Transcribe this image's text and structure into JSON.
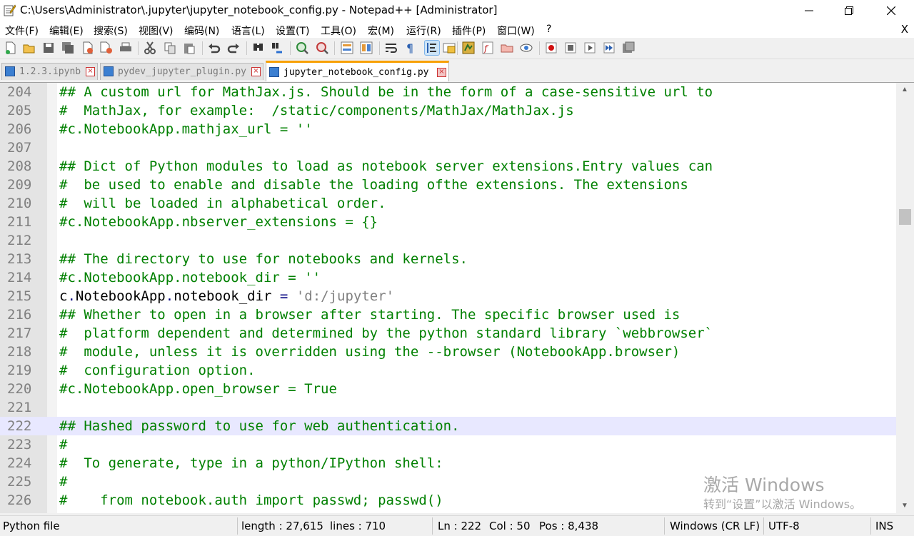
{
  "window": {
    "title": "C:\\Users\\Administrator\\.jupyter\\jupyter_notebook_config.py - Notepad++ [Administrator]",
    "minimize": "—",
    "maximize": "☐",
    "close": "✕"
  },
  "menu": {
    "items": [
      "文件(F)",
      "编辑(E)",
      "搜索(S)",
      "视图(V)",
      "编码(N)",
      "语言(L)",
      "设置(T)",
      "工具(O)",
      "宏(M)",
      "运行(R)",
      "插件(P)",
      "窗口(W)",
      "?"
    ],
    "close": "X"
  },
  "toolbar": {
    "icons": [
      "new-file-icon",
      "open-file-icon",
      "save-icon",
      "save-all-icon",
      "close-icon",
      "close-all-icon",
      "print-icon",
      "cut-icon",
      "copy-icon",
      "paste-icon",
      "undo-icon",
      "redo-icon",
      "find-icon",
      "replace-icon",
      "zoom-in-icon",
      "zoom-out-icon",
      "sync-vertical-icon",
      "sync-horizontal-icon",
      "word-wrap-icon",
      "show-all-chars-icon",
      "indent-guide-icon",
      "user-lang-icon",
      "doc-map-icon",
      "function-list-icon",
      "folder-workspace-icon",
      "monitoring-icon",
      "record-macro-icon",
      "stop-record-icon",
      "play-macro-icon",
      "run-macro-multiple-icon",
      "save-macro-icon"
    ]
  },
  "tabs": [
    {
      "label": "1.2.3.ipynb",
      "active": false
    },
    {
      "label": "pydev_jupyter_plugin.py",
      "active": false
    },
    {
      "label": "jupyter_notebook_config.py",
      "active": true
    }
  ],
  "editor": {
    "current_line": 222,
    "lines": [
      {
        "n": "204",
        "type": "comment",
        "text": "## A custom url for MathJax.js. Should be in the form of a case-sensitive url to"
      },
      {
        "n": "205",
        "type": "comment",
        "text": "#  MathJax, for example:  /static/components/MathJax/MathJax.js"
      },
      {
        "n": "206",
        "type": "comment",
        "text": "#c.NotebookApp.mathjax_url = ''"
      },
      {
        "n": "207",
        "type": "empty",
        "text": ""
      },
      {
        "n": "208",
        "type": "comment",
        "text": "## Dict of Python modules to load as notebook server extensions.Entry values can"
      },
      {
        "n": "209",
        "type": "comment",
        "text": "#  be used to enable and disable the loading ofthe extensions. The extensions"
      },
      {
        "n": "210",
        "type": "comment",
        "text": "#  will be loaded in alphabetical order."
      },
      {
        "n": "211",
        "type": "comment",
        "text": "#c.NotebookApp.nbserver_extensions = {}"
      },
      {
        "n": "212",
        "type": "empty",
        "text": ""
      },
      {
        "n": "213",
        "type": "comment",
        "text": "## The directory to use for notebooks and kernels."
      },
      {
        "n": "214",
        "type": "comment",
        "text": "#c.NotebookApp.notebook_dir = ''"
      },
      {
        "n": "215",
        "type": "code",
        "text": "c.NotebookApp.notebook_dir = 'd:/jupyter'",
        "parts": {
          "obj": "c",
          "d1": ".",
          "cls": "NotebookApp",
          "d2": ".",
          "attr": "notebook_dir",
          "eq": " = ",
          "str": "'d:/jupyter'"
        }
      },
      {
        "n": "216",
        "type": "comment",
        "text": "## Whether to open in a browser after starting. The specific browser used is"
      },
      {
        "n": "217",
        "type": "comment",
        "text": "#  platform dependent and determined by the python standard library `webbrowser`"
      },
      {
        "n": "218",
        "type": "comment",
        "text": "#  module, unless it is overridden using the --browser (NotebookApp.browser)"
      },
      {
        "n": "219",
        "type": "comment",
        "text": "#  configuration option."
      },
      {
        "n": "220",
        "type": "comment",
        "text": "#c.NotebookApp.open_browser = True"
      },
      {
        "n": "221",
        "type": "empty",
        "text": ""
      },
      {
        "n": "222",
        "type": "comment",
        "text": "## Hashed password to use for web authentication."
      },
      {
        "n": "223",
        "type": "comment",
        "text": "#"
      },
      {
        "n": "224",
        "type": "comment",
        "text": "#  To generate, type in a python/IPython shell:"
      },
      {
        "n": "225",
        "type": "comment",
        "text": "#"
      },
      {
        "n": "226",
        "type": "comment",
        "text": "#    from notebook.auth import passwd; passwd()"
      }
    ]
  },
  "watermark": {
    "title": "激活 Windows",
    "subtitle": "转到“设置”以激活 Windows。"
  },
  "status": {
    "language": "Python file",
    "length": "length : 27,615",
    "lines": "lines : 710",
    "ln": "Ln : 222",
    "col": "Col : 50",
    "pos": "Pos : 8,438",
    "eol": "Windows (CR LF)",
    "encoding": "UTF-8",
    "mode": "INS"
  },
  "colors": {
    "comment": "#008000",
    "string": "#808080",
    "current_line": "#e8e8ff",
    "tab_accent": "#f8a000"
  }
}
